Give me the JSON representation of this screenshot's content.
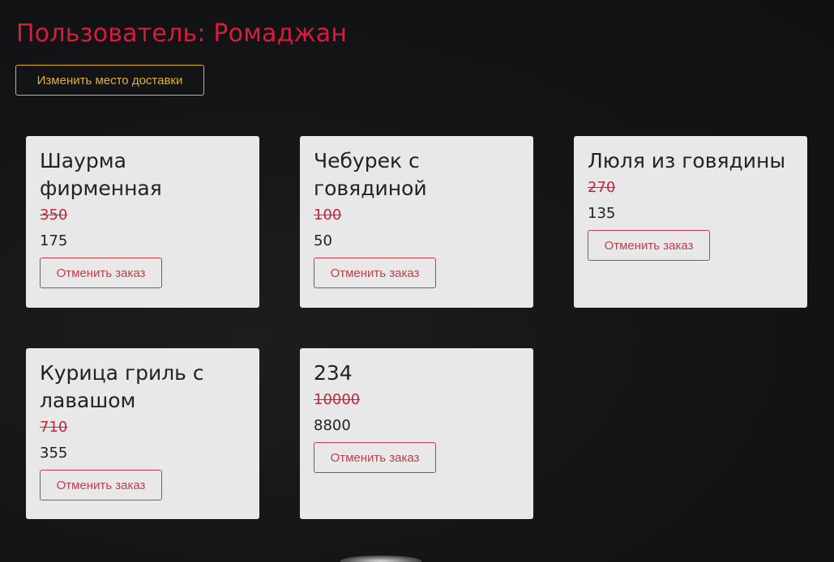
{
  "user_title": "Пользователь: Ромаджан",
  "change_address_label": "Изменить место доставки",
  "cancel_label": "Отменить заказ",
  "colors": {
    "title": "#d81c3c",
    "accent_yellow": "#e3b032",
    "old_price": "#c4263c",
    "cancel": "#c83a4c"
  },
  "orders": [
    {
      "name": "Шаурма фирменная",
      "old_price": "350",
      "price": "175"
    },
    {
      "name": "Чебурек с говядиной",
      "old_price": "100",
      "price": "50"
    },
    {
      "name": "Люля из говядины",
      "old_price": "270",
      "price": "135"
    },
    {
      "name": "Курица гриль с лавашом",
      "old_price": "710",
      "price": "355"
    },
    {
      "name": "234",
      "old_price": "10000",
      "price": "8800"
    }
  ]
}
